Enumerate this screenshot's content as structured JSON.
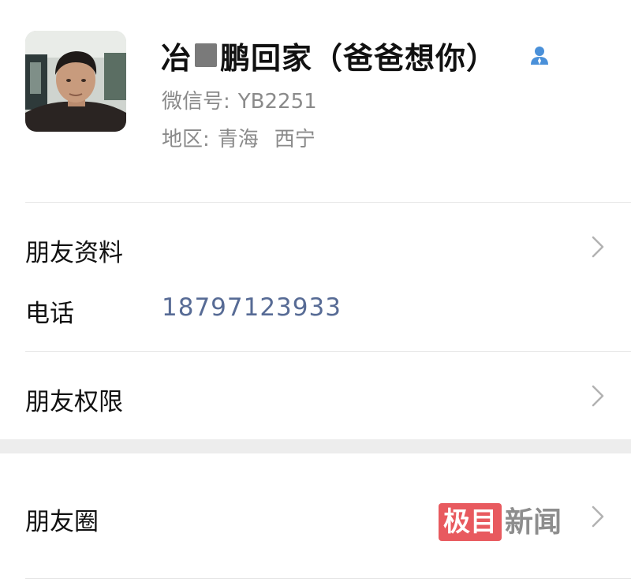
{
  "profile": {
    "name_before": "冶",
    "name_after": "鹏回家（爸爸想你）",
    "wechat_label": "微信号:",
    "wechat_id": "YB2251",
    "region_label": "地区:",
    "region_province": "青海",
    "region_city": "西宁",
    "contact_icon": "contact-person-icon"
  },
  "rows": {
    "friend_info": "朋友资料",
    "phone_label": "电话",
    "phone_value": "18797123933",
    "friend_permissions": "朋友权限",
    "moments": "朋友圈"
  },
  "watermark": {
    "boxed": "极目",
    "text": "新闻"
  },
  "colors": {
    "link_blue": "#576b95",
    "secondary_gray": "#8a8a8a",
    "icon_blue": "#4a90d9",
    "watermark_red": "#e85a5f",
    "section_gap": "#ededed"
  }
}
